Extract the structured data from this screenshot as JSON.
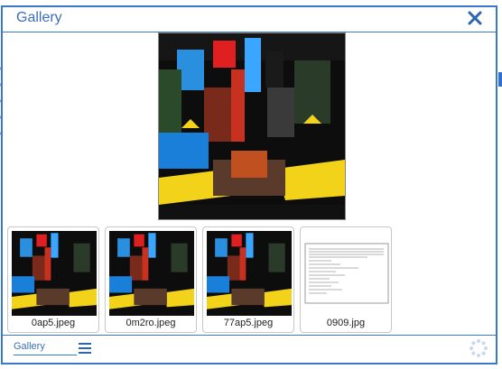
{
  "modal": {
    "title": "Gallery",
    "close_icon": "close-icon"
  },
  "thumbnails": [
    {
      "caption": "0ap5.jpeg",
      "kind": "photo"
    },
    {
      "caption": "0m2ro.jpeg",
      "kind": "photo"
    },
    {
      "caption": "77ap5.jpeg",
      "kind": "photo"
    },
    {
      "caption": "0909.jpg",
      "kind": "document"
    }
  ],
  "footer": {
    "link_label": "Gallery",
    "menu_icon": "hamburger-menu-icon",
    "spinner_icon": "loading-spinner-icon"
  },
  "colors": {
    "accent": "#3a78c9",
    "title": "#3a6fb8"
  }
}
